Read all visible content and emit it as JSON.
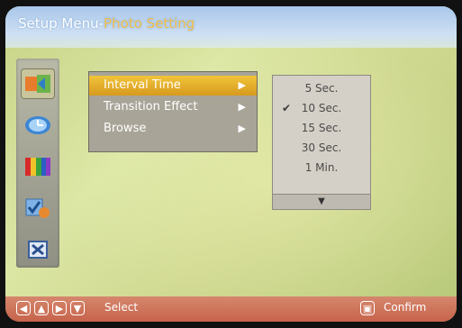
{
  "header": {
    "title_prefix": "Setup Menu-",
    "title_section": "Photo Setting"
  },
  "sidebar": {
    "items": [
      {
        "icon": "photo-setting-icon",
        "selected": true
      },
      {
        "icon": "clock-icon",
        "selected": false
      },
      {
        "icon": "display-color-bars-icon",
        "selected": false
      },
      {
        "icon": "checklist-icon",
        "selected": false
      },
      {
        "icon": "exit-icon",
        "selected": false
      }
    ]
  },
  "menu": {
    "items": [
      {
        "label": "Interval Time",
        "arrow": "▶",
        "selected": true
      },
      {
        "label": "Transition Effect",
        "arrow": "▶",
        "selected": false
      },
      {
        "label": "Browse",
        "arrow": "▶",
        "selected": false
      }
    ]
  },
  "submenu": {
    "items": [
      {
        "label": "5 Sec.",
        "checked": false
      },
      {
        "label": "10 Sec.",
        "checked": true
      },
      {
        "label": "15 Sec.",
        "checked": false
      },
      {
        "label": "30 Sec.",
        "checked": false
      },
      {
        "label": "1 Min.",
        "checked": false
      }
    ],
    "more_glyph": "▼",
    "check_glyph": "✔"
  },
  "footer": {
    "nav_icons": [
      "◀",
      "▲",
      "▶",
      "▼"
    ],
    "select_label": "Select",
    "confirm_icon": "▣",
    "confirm_label": "Confirm"
  },
  "colors": {
    "highlight": "#e9b531",
    "title_accent": "#f8c34a",
    "bottom_bar": "#c9694f"
  }
}
